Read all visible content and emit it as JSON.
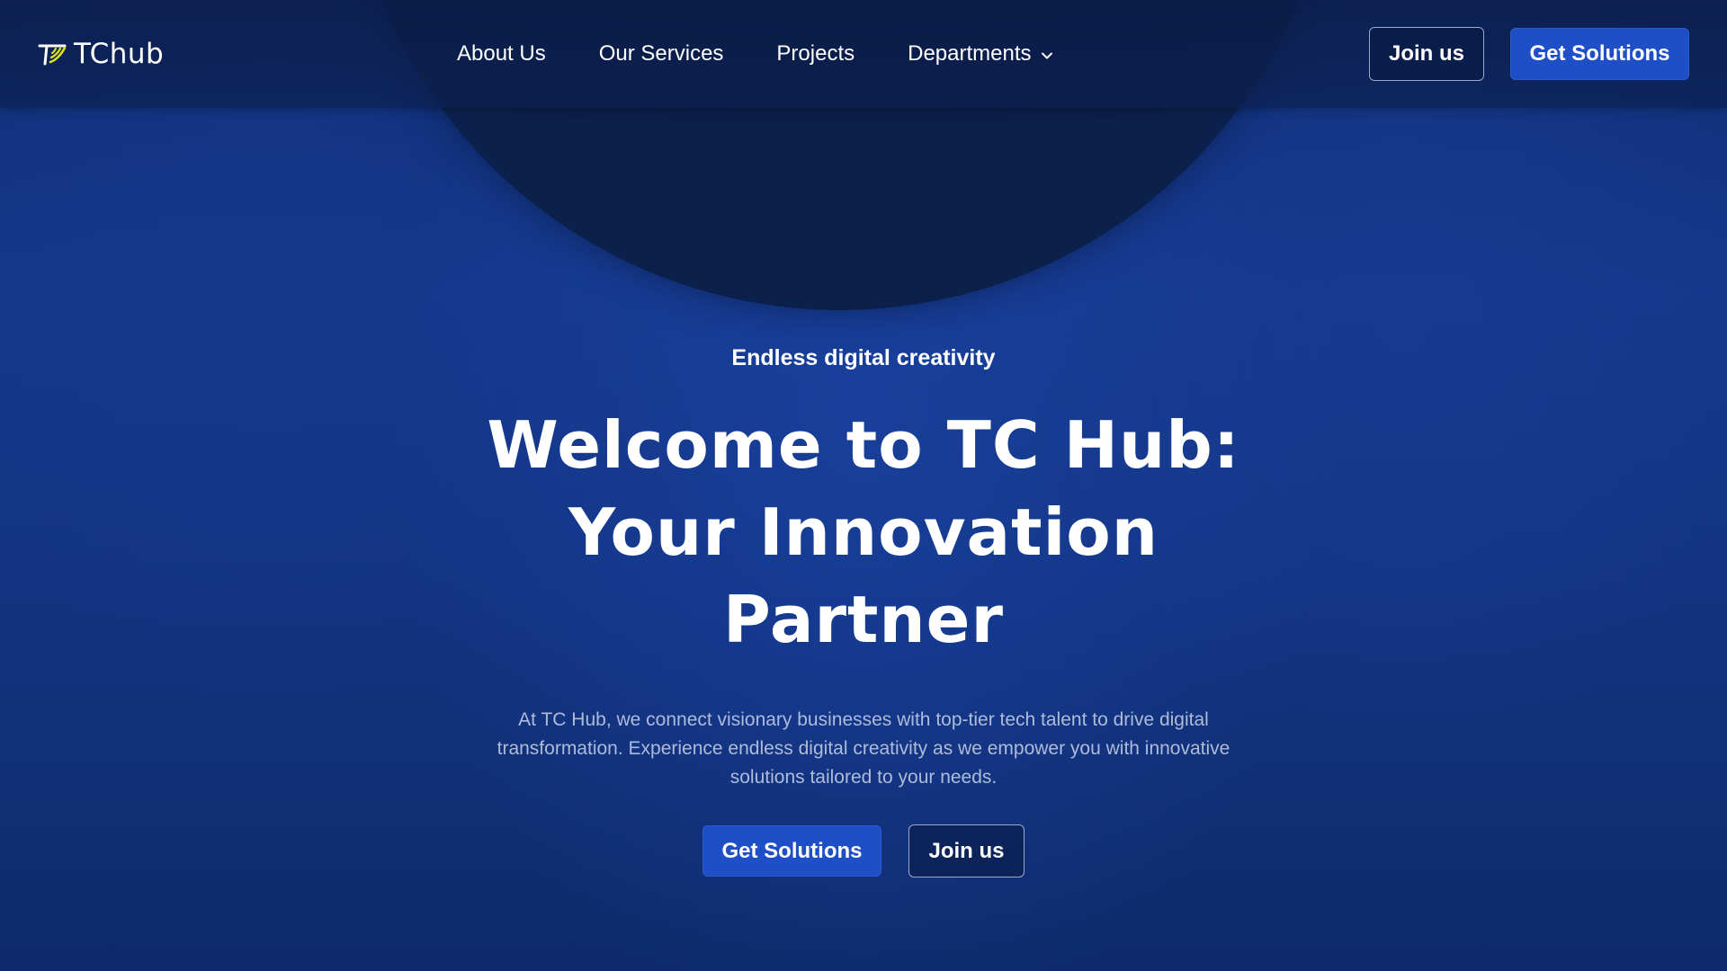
{
  "header": {
    "logo_text": "TChub",
    "nav_items": [
      {
        "label": "About Us"
      },
      {
        "label": "Our Services"
      },
      {
        "label": "Projects"
      },
      {
        "label": "Departments",
        "has_dropdown": true
      }
    ],
    "join_label": "Join us",
    "get_solutions_label": "Get Solutions"
  },
  "hero": {
    "tagline": "Endless digital creativity",
    "headline_lines": [
      "Welcome to TC Hub:",
      "Your Innovation",
      "Partner"
    ],
    "description": "At TC Hub, we connect visionary businesses with top-tier tech talent to drive digital transformation. Experience endless digital creativity as we empower you with innovative solutions tailored to your needs.",
    "primary_cta": "Get Solutions",
    "secondary_cta": "Join us"
  },
  "colors": {
    "background": "#14388a",
    "accent_button": "#1f4fc6",
    "logo_accent": "#d8e020",
    "muted_text": "#aebbd9"
  },
  "icons": {
    "logo": "tchub-logo-icon",
    "dropdown": "chevron-down-icon"
  }
}
